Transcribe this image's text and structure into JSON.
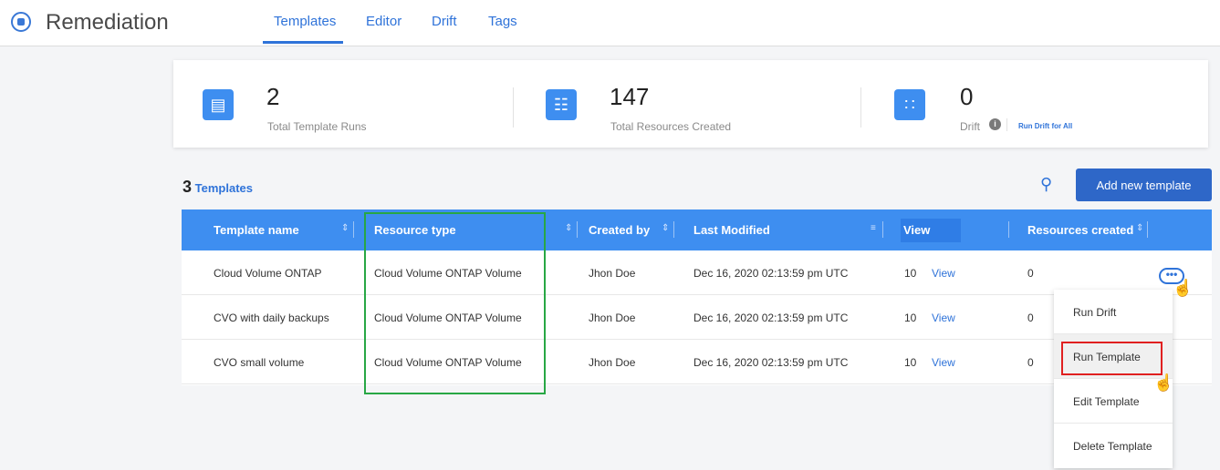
{
  "app": {
    "title": "Remediation"
  },
  "tabs": [
    {
      "label": "Templates",
      "active": true
    },
    {
      "label": "Editor"
    },
    {
      "label": "Drift"
    },
    {
      "label": "Tags"
    }
  ],
  "stats": {
    "runs": {
      "value": "2",
      "label": "Total Template Runs",
      "icon": "document-icon"
    },
    "resources": {
      "value": "147",
      "label": "Total Resources Created",
      "icon": "hierarchy-icon"
    },
    "drift": {
      "value": "0",
      "label": "Drift",
      "icon": "nodes-icon",
      "action": "Run Drift for All"
    }
  },
  "templates_header": {
    "count": "3",
    "label": "Templates",
    "add_button": "Add new template"
  },
  "table": {
    "columns": [
      "Template name",
      "Resource type",
      "Created by",
      "Last Modified",
      "View",
      "Resources created"
    ],
    "rows": [
      {
        "name": "Cloud Volume ONTAP",
        "type": "Cloud Volume ONTAP  Volume",
        "created_by": "Jhon Doe",
        "modified": "Dec 16, 2020 02:13:59 pm UTC",
        "count": "10",
        "view": "View",
        "resources": "0"
      },
      {
        "name": "CVO with daily backups",
        "type": "Cloud Volume ONTAP  Volume",
        "created_by": "Jhon Doe",
        "modified": "Dec 16, 2020 02:13:59 pm UTC",
        "count": "10",
        "view": "View",
        "resources": "0"
      },
      {
        "name": "CVO small volume",
        "type": "Cloud Volume ONTAP  Volume",
        "created_by": "Jhon Doe",
        "modified": "Dec 16, 2020 02:13:59 pm UTC",
        "count": "10",
        "view": "View",
        "resources": "0"
      }
    ]
  },
  "menu": {
    "items": [
      "Run Drift",
      "Run Template",
      "Edit Template",
      "Delete Template"
    ]
  },
  "colors": {
    "accent": "#2f73d9",
    "header": "#3e8ef0",
    "highlight_green": "#28a745",
    "highlight_red": "#e02020"
  }
}
